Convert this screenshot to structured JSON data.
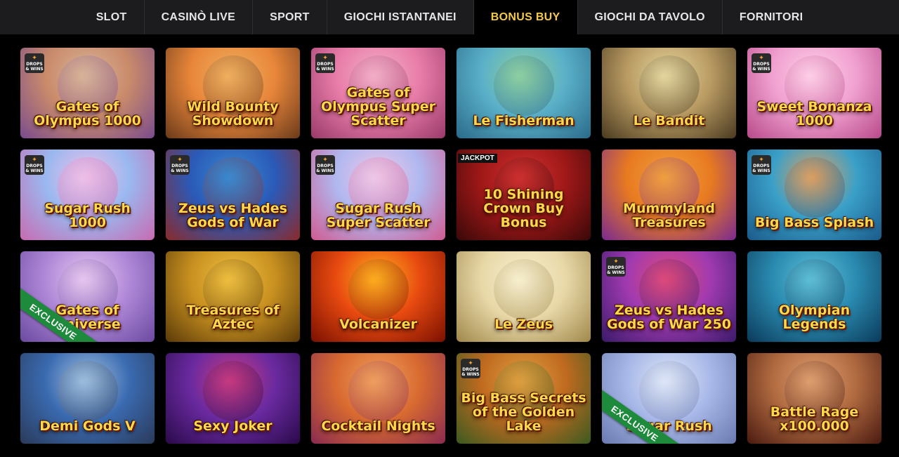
{
  "nav": {
    "tabs": [
      {
        "label": "SLOT",
        "active": false
      },
      {
        "label": "CASINÒ LIVE",
        "active": false
      },
      {
        "label": "SPORT",
        "active": false
      },
      {
        "label": "GIOCHI ISTANTANEI",
        "active": false
      },
      {
        "label": "BONUS BUY",
        "active": true
      },
      {
        "label": "GIOCHI DA TAVOLO",
        "active": false
      },
      {
        "label": "FORNITORI",
        "active": false
      }
    ]
  },
  "badges": {
    "drops_line1": "DROPS",
    "drops_line2": "& WINS",
    "jackpot": "JACKPOT",
    "exclusive": "EXCLUSIVE"
  },
  "colors": {
    "nav_active_text": "#f2c94c",
    "nav_bg": "#1c1c1f",
    "exclusive_ribbon": "#1e8a3c"
  },
  "games": [
    {
      "title": "Gates of Olympus 1000",
      "bg": [
        "#c98a6a",
        "#d9b59a",
        "#7a4b8e"
      ],
      "drops": true
    },
    {
      "title": "Wild Bounty Showdown",
      "bg": [
        "#e8863a",
        "#f0b060",
        "#6a3a1a"
      ],
      "drops": false
    },
    {
      "title": "Gates of Olympus Super Scatter",
      "bg": [
        "#e87ca8",
        "#f4b0c8",
        "#9a3a6a"
      ],
      "drops": true
    },
    {
      "title": "Le Fisherman",
      "bg": [
        "#5ab0c8",
        "#8fd0a0",
        "#2a6a8a"
      ],
      "drops": false
    },
    {
      "title": "Le Bandit",
      "bg": [
        "#b89a62",
        "#e6d8a0",
        "#4a3a20"
      ],
      "drops": false
    },
    {
      "title": "Sweet Bonanza 1000",
      "bg": [
        "#f0a0d0",
        "#ffd0e8",
        "#b84a8a"
      ],
      "drops": true
    },
    {
      "title": "Sugar Rush 1000",
      "bg": [
        "#9ab8f0",
        "#f0c0e8",
        "#c86ab0"
      ],
      "drops": true
    },
    {
      "title": "Zeus vs Hades Gods of War",
      "bg": [
        "#2a5ab8",
        "#3a8ad0",
        "#8a2a2a"
      ],
      "drops": true
    },
    {
      "title": "Sugar Rush Super Scatter",
      "bg": [
        "#b0b8f0",
        "#f0c8e8",
        "#d05a90"
      ],
      "drops": true
    },
    {
      "title": "10 Shining Crown Buy Bonus",
      "bg": [
        "#a01818",
        "#d03030",
        "#3a0808"
      ],
      "jackpot": true
    },
    {
      "title": "Mummyland Treasures",
      "bg": [
        "#e87a20",
        "#f0a040",
        "#7a2a90"
      ],
      "drops": false
    },
    {
      "title": "Big Bass Splash",
      "bg": [
        "#3aa0c8",
        "#e0a060",
        "#1a5a8a"
      ],
      "drops": true
    },
    {
      "title": "Gates of Universe",
      "bg": [
        "#b088d8",
        "#e8c8f0",
        "#6a4aa0"
      ],
      "exclusive": true
    },
    {
      "title": "Treasures of Aztec",
      "bg": [
        "#c89020",
        "#f0c040",
        "#5a3a08"
      ],
      "drops": false
    },
    {
      "title": "Volcanizer",
      "bg": [
        "#e84a10",
        "#ffb020",
        "#7a1000"
      ],
      "drops": false
    },
    {
      "title": "Le Zeus",
      "bg": [
        "#e8d8a8",
        "#f8f0d0",
        "#a0884a"
      ],
      "drops": false
    },
    {
      "title": "Zeus vs Hades Gods of War 250",
      "bg": [
        "#a03ab0",
        "#e04a7a",
        "#3a1a6a"
      ],
      "drops": true
    },
    {
      "title": "Olympian Legends",
      "bg": [
        "#2a8ab0",
        "#60c0d8",
        "#0a3a5a"
      ],
      "drops": false
    },
    {
      "title": "Demi Gods V",
      "bg": [
        "#3a6ab0",
        "#a0c0e0",
        "#2a3a5a"
      ],
      "drops": false
    },
    {
      "title": "Sexy Joker",
      "bg": [
        "#6a2aa0",
        "#c83a80",
        "#2a0a4a"
      ],
      "drops": false
    },
    {
      "title": "Cocktail Nights",
      "bg": [
        "#d86a30",
        "#f0a060",
        "#8a2a50"
      ],
      "drops": false
    },
    {
      "title": "Big Bass Secrets of the Golden Lake",
      "bg": [
        "#c06a20",
        "#e0a040",
        "#3a5a20"
      ],
      "drops": true
    },
    {
      "title": "Sugar Rush",
      "bg": [
        "#a8b8e8",
        "#e0e8f8",
        "#6a7ab0"
      ],
      "exclusive": true
    },
    {
      "title": "Battle Rage x100.000",
      "bg": [
        "#b06a40",
        "#e0a070",
        "#4a1a10"
      ],
      "drops": false
    }
  ]
}
